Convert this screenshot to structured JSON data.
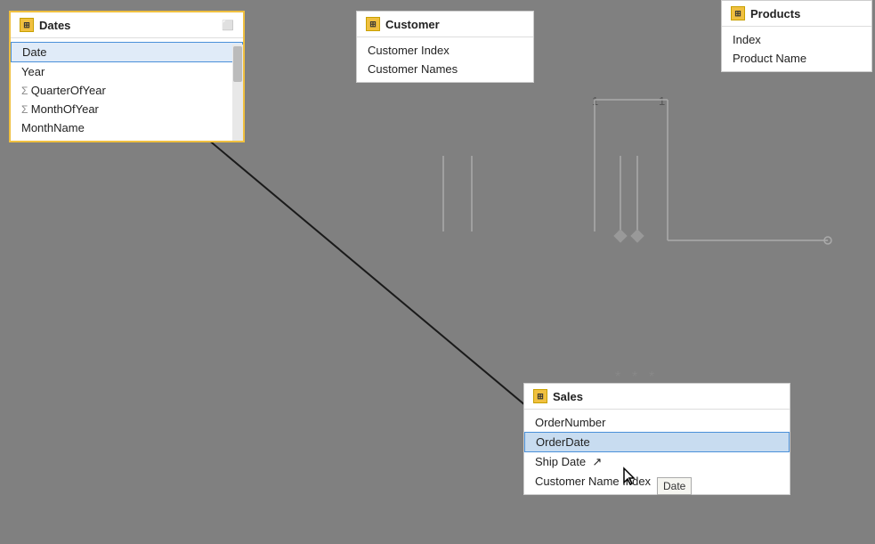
{
  "tables": {
    "dates": {
      "title": "Dates",
      "rows": [
        {
          "label": "Date",
          "type": "normal",
          "selected": true
        },
        {
          "label": "Year",
          "type": "normal"
        },
        {
          "label": "QuarterOfYear",
          "type": "sigma"
        },
        {
          "label": "MonthOfYear",
          "type": "sigma"
        },
        {
          "label": "MonthName",
          "type": "normal"
        }
      ]
    },
    "customer": {
      "title": "Customer",
      "rows": [
        {
          "label": "Customer Index",
          "type": "normal"
        },
        {
          "label": "Customer Names",
          "type": "normal"
        }
      ]
    },
    "products": {
      "title": "Products",
      "rows": [
        {
          "label": "Index",
          "type": "normal"
        },
        {
          "label": "Product Name",
          "type": "normal"
        }
      ]
    },
    "sales": {
      "title": "Sales",
      "rows": [
        {
          "label": "OrderNumber",
          "type": "normal"
        },
        {
          "label": "OrderDate",
          "type": "normal",
          "highlighted": true
        },
        {
          "label": "Ship Date",
          "type": "normal"
        },
        {
          "label": "Customer Name Index",
          "type": "normal"
        }
      ]
    }
  },
  "tooltip": {
    "text": "Date"
  },
  "relationship_labels": {
    "one_left": "1",
    "one_right": "1",
    "many_left": "*",
    "many_middle": "*",
    "many_right": "*"
  }
}
